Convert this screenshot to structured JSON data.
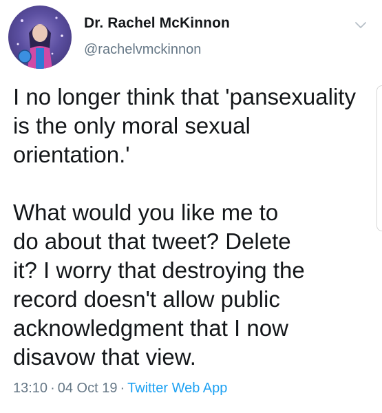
{
  "author": {
    "display_name": "Dr. Rachel McKinnon",
    "handle": "@rachelvmckinnon",
    "avatar_icon": "profile-avatar"
  },
  "tweet": {
    "text": "I no longer think that 'pansexuality\nis the only moral sexual\norientation.'\n\nWhat would you like me to\ndo about that tweet? Delete\nit? I worry that destroying the\nrecord doesn't allow public\nacknowledgment that I now\ndisavow that view."
  },
  "meta": {
    "time": "13:10",
    "date": "04 Oct 19",
    "separator": "·",
    "source": "Twitter Web App"
  },
  "icons": {
    "caret": "chevron-down-icon"
  },
  "colors": {
    "text": "#14171a",
    "secondary": "#657786",
    "link": "#1da1f2",
    "background": "#ffffff"
  }
}
